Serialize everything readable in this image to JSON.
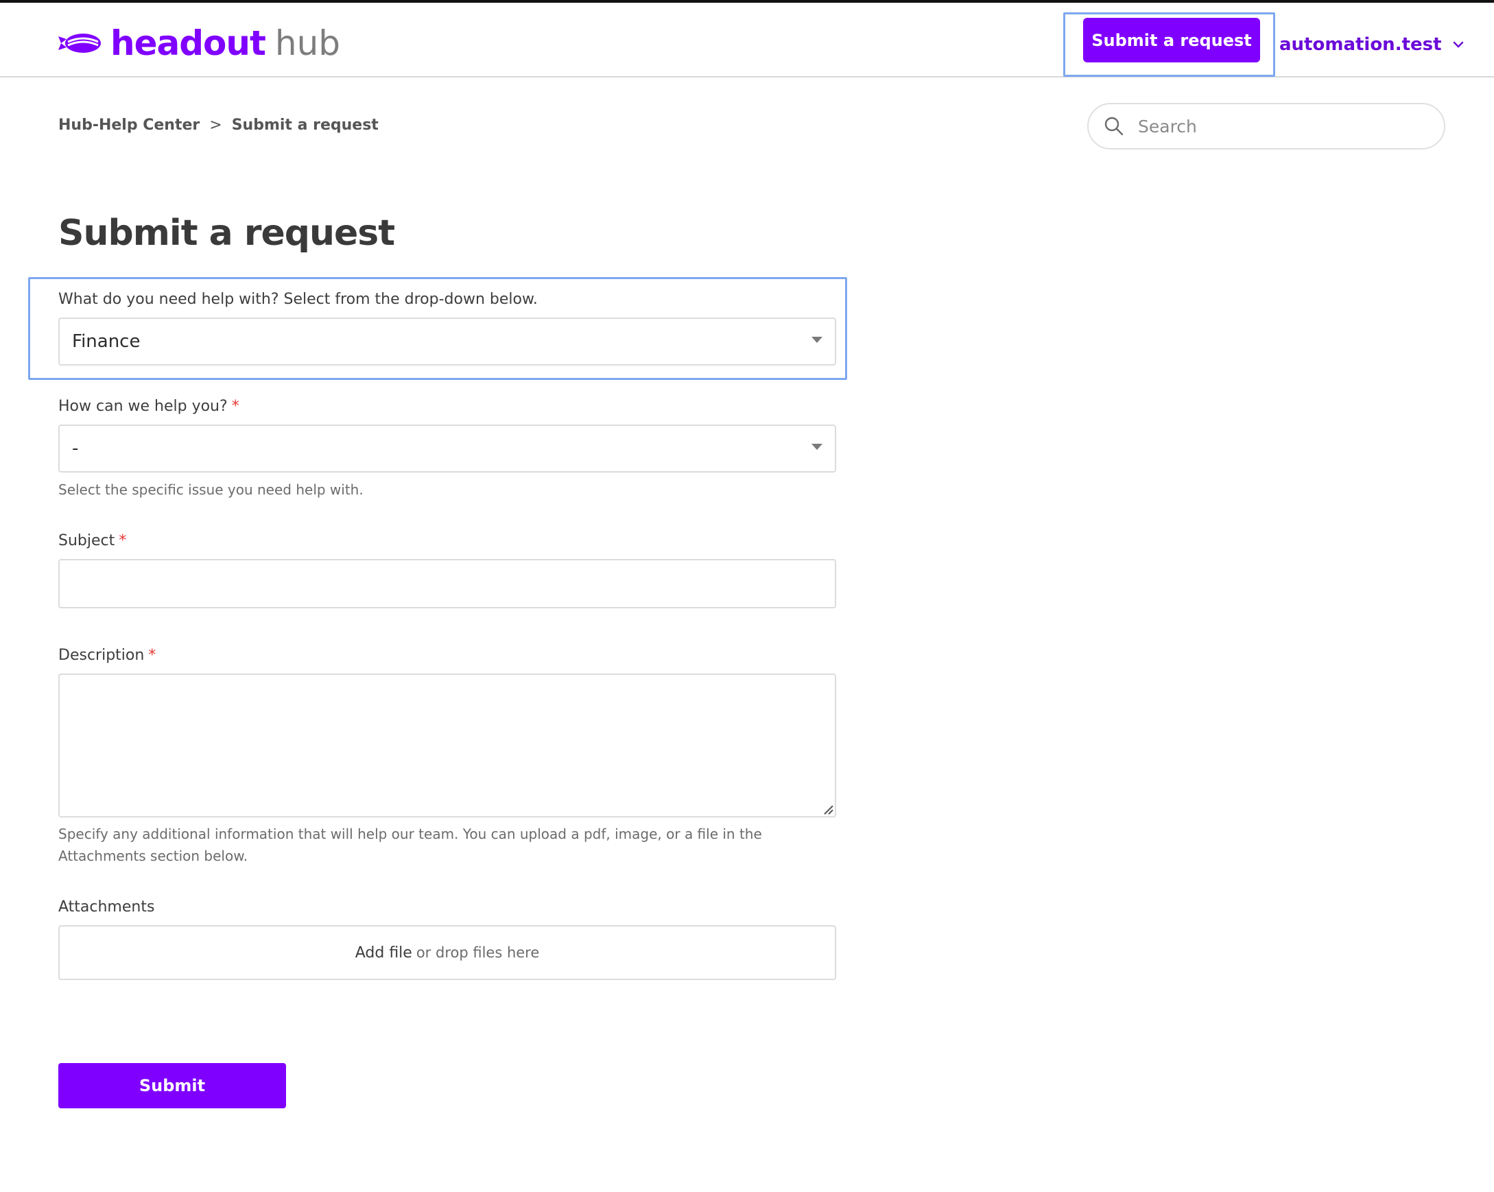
{
  "brand": {
    "name_primary": "headout",
    "name_secondary": "hub",
    "accent_color": "#8000ff",
    "icon": "blimp-logo-icon"
  },
  "header": {
    "submit_request_label": "Submit a request",
    "user_name": "automation.test",
    "user_menu_icon": "chevron-down-icon"
  },
  "breadcrumb": {
    "items": [
      "Hub-Help Center",
      "Submit a request"
    ],
    "separator": ">"
  },
  "search": {
    "placeholder": "Search",
    "icon": "search-icon"
  },
  "page": {
    "title": "Submit a request"
  },
  "form": {
    "category": {
      "label": "What do you need help with? Select from the drop-down below.",
      "value": "Finance"
    },
    "issue": {
      "label": "How can we help you?",
      "required_mark": "*",
      "value": "-",
      "hint": "Select the specific issue you need help with."
    },
    "subject": {
      "label": "Subject",
      "required_mark": "*",
      "value": ""
    },
    "description": {
      "label": "Description",
      "required_mark": "*",
      "value": "",
      "hint": "Specify any additional information that will help our team. You can upload a pdf, image, or a file in the Attachments section below."
    },
    "attachments": {
      "label": "Attachments",
      "add_file": "Add file",
      "drop_text": "or drop files here"
    },
    "submit_label": "Submit"
  }
}
